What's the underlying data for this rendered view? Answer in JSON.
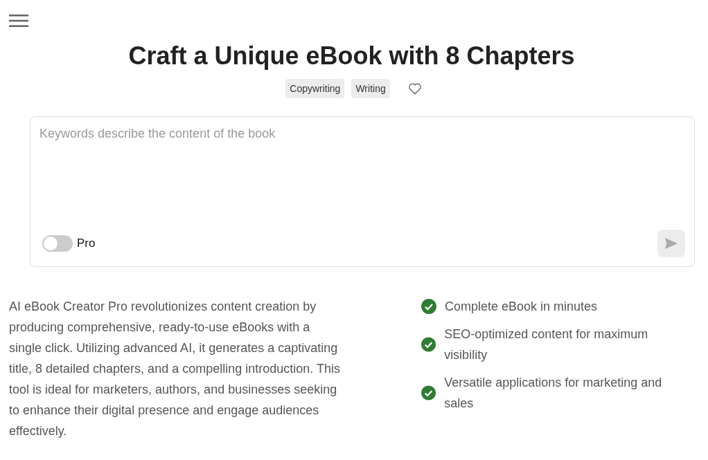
{
  "title": "Craft a Unique eBook with 8 Chapters",
  "tags": [
    {
      "label": "Copywriting"
    },
    {
      "label": "Writing"
    }
  ],
  "favorite": {
    "on": false
  },
  "prompt": {
    "placeholder": "Keywords describe the content of the book",
    "pro_toggle": {
      "label": "Pro",
      "on": false
    },
    "send_button": {
      "disabled": true
    }
  },
  "description": "AI eBook Creator Pro revolutionizes content creation by producing comprehensive, ready-to-use eBooks with a single click. Utilizing advanced AI, it generates a captivating title, 8 detailed chapters, and a compelling introduction. This tool is ideal for marketers, authors, and businesses seeking to enhance their digital presence and engage audiences effectively.",
  "features": [
    {
      "text": "Complete eBook in minutes"
    },
    {
      "text": "SEO-optimized content for maximum visibility"
    },
    {
      "text": "Versatile applications for marketing and sales"
    }
  ]
}
